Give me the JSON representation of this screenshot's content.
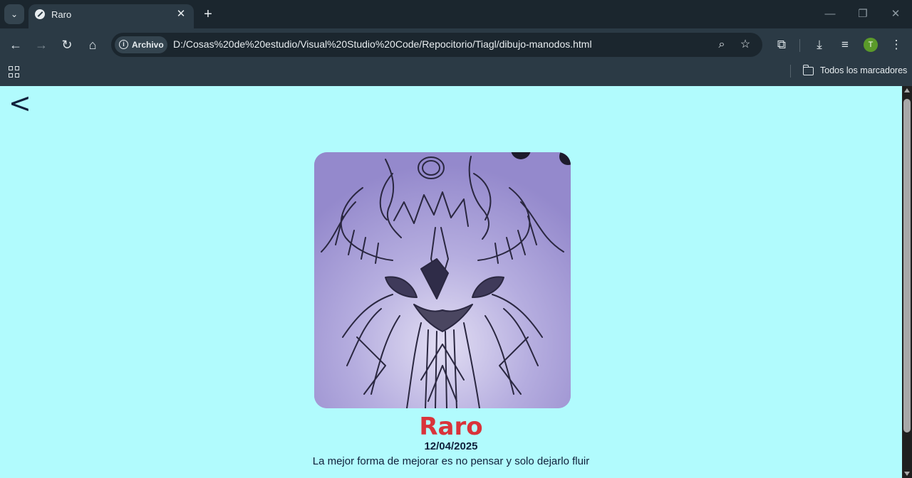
{
  "browser": {
    "tab_title": "Raro",
    "security_chip": "Archivo",
    "url": "D:/Cosas%20de%20estudio/Visual%20Studio%20Code/Repocitorio/Tiagl/dibujo-manodos.html",
    "profile_initial": "T",
    "bookmarks_label": "Todos los marcadores",
    "accent": "#5b9a2a"
  },
  "page": {
    "back_label": "<",
    "background": "#b1fbfd",
    "title": "Raro",
    "title_color": "#d9333a",
    "date": "12/04/2025",
    "description": "La mejor forma de mejorar es no pensar y solo dejarlo fluir",
    "image_icon": "pencil-sketch-drawing"
  }
}
